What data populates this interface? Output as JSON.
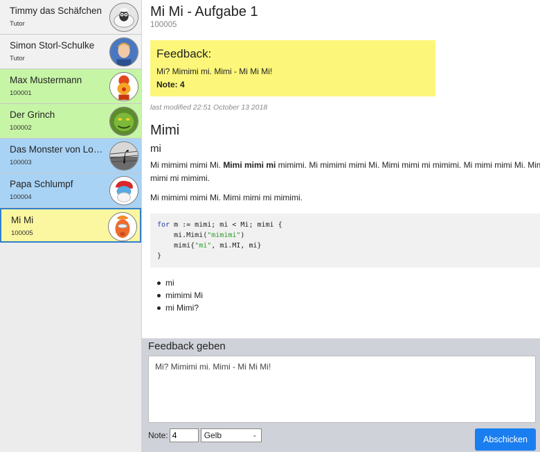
{
  "students": [
    {
      "name": "Timmy das Schäfchen",
      "sub": "Tutor",
      "status": "white",
      "avatar": "sheep-avatar"
    },
    {
      "name": "Simon Storl-Schulke",
      "sub": "Tutor",
      "status": "white",
      "avatar": "person-avatar"
    },
    {
      "name": "Max Mustermann",
      "sub": "100001",
      "status": "green",
      "avatar": "clown-avatar"
    },
    {
      "name": "Der Grinch",
      "sub": "100002",
      "status": "green",
      "avatar": "grinch-avatar"
    },
    {
      "name": "Das Monster von Loc...",
      "sub": "100003",
      "status": "blue",
      "avatar": "nessie-avatar"
    },
    {
      "name": "Papa Schlumpf",
      "sub": "100004",
      "status": "blue",
      "avatar": "smurf-avatar"
    },
    {
      "name": "Mi Mi",
      "sub": "100005",
      "status": "yellow-selected",
      "avatar": "beaker-avatar"
    }
  ],
  "submission": {
    "title": "Mi Mi - Aufgabe 1",
    "id": "100005"
  },
  "feedback": {
    "title": "Feedback:",
    "text": "Mi? Mimimi mi. Mimi - Mi Mi Mi!",
    "note": "Note: 4"
  },
  "last_modified": "last modified 22:51 October 13 2018",
  "body": {
    "heading1": "Mimi",
    "heading2": "mi",
    "para1_a": "Mi mimimi mimi Mi. ",
    "para1_bold": "Mimi mimi mi",
    "para1_b": " mimimi. Mi mimimi mimi Mi. Mimi mimi mi mimimi. Mi mimi mimi Mi. Mimi mimi mi mimimi.",
    "para2": "Mi mimimi mimi Mi. Mimi mimi mi mimimi.",
    "code": {
      "line1_kw": "for",
      "line1_rest": " m := mimi; mi < Mi; mimi {",
      "line2_a": "    mi.Mimi(",
      "line2_str": "\"mimimi\"",
      "line2_b": ")",
      "line3_a": "    mimi{",
      "line3_str": "\"mi\"",
      "line3_b": ", mi.MI, mi}",
      "line4": "}"
    },
    "list": [
      "mi",
      "mimimi Mi",
      "mi Mimi?"
    ]
  },
  "give_feedback": {
    "title": "Feedback geben",
    "textarea_value": "Mi? Mimimi mi. Mimi - Mi Mi Mi!",
    "note_label": "Note:",
    "note_value": "4",
    "color_value": "Gelb",
    "submit_label": "Abschicken"
  },
  "colors": {
    "green": "#c7f5a6",
    "blue": "#a9d3f5",
    "yellow": "#fbf7a0",
    "feedback_bg": "#fcf77a",
    "accent": "#1a7ef0"
  }
}
